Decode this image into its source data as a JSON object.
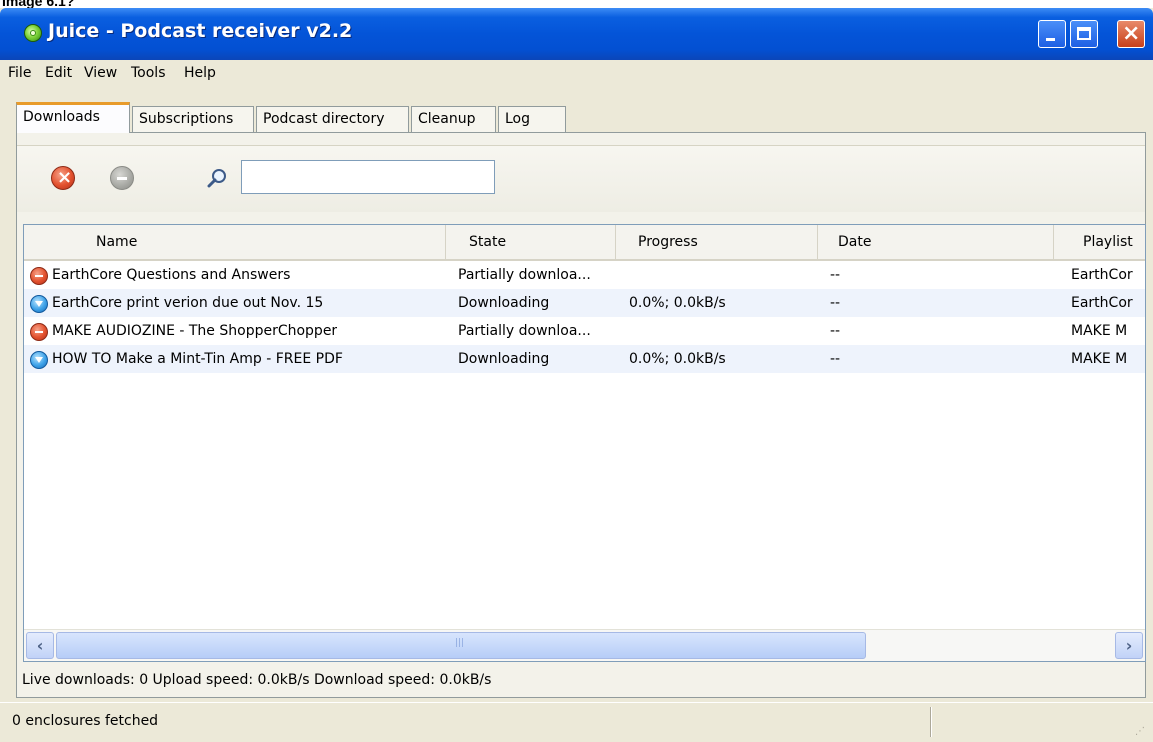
{
  "caption": "Image 6.1?",
  "window": {
    "title": "Juice - Podcast receiver v2.2"
  },
  "menu": [
    "File",
    "Edit",
    "View",
    "Tools",
    "Help"
  ],
  "tabs": [
    "Downloads",
    "Subscriptions",
    "Podcast directory",
    "Cleanup",
    "Log"
  ],
  "active_tab": "Downloads",
  "search": {
    "value": ""
  },
  "table": {
    "headers": [
      "Name",
      "State",
      "Progress",
      "Date",
      "Playlist"
    ],
    "rows": [
      {
        "icon": "stop-icon",
        "name": "EarthCore Questions and Answers",
        "state": "Partially downloa...",
        "progress": "",
        "date": "--",
        "playlist": "EarthCor"
      },
      {
        "icon": "download-icon",
        "name": "EarthCore print verion due out Nov. 15",
        "state": "Downloading",
        "progress": "0.0%; 0.0kB/s",
        "date": "--",
        "playlist": "EarthCor"
      },
      {
        "icon": "stop-icon",
        "name": "MAKE AUDIOZINE - The ShopperChopper",
        "state": "Partially downloa...",
        "progress": "",
        "date": "--",
        "playlist": "MAKE M"
      },
      {
        "icon": "download-icon",
        "name": "HOW TO Make a Mint-Tin Amp - FREE PDF",
        "state": "Downloading",
        "progress": "0.0%; 0.0kB/s",
        "date": "--",
        "playlist": "MAKE M"
      }
    ]
  },
  "status_line": "Live downloads: 0 Upload speed: 0.0kB/s Download speed: 0.0kB/s",
  "statusbar": "0 enclosures fetched",
  "colors": {
    "titlebar": "#0454d8",
    "active_tab_accent": "#e89b2a",
    "alt_row": "#eef3fc"
  }
}
